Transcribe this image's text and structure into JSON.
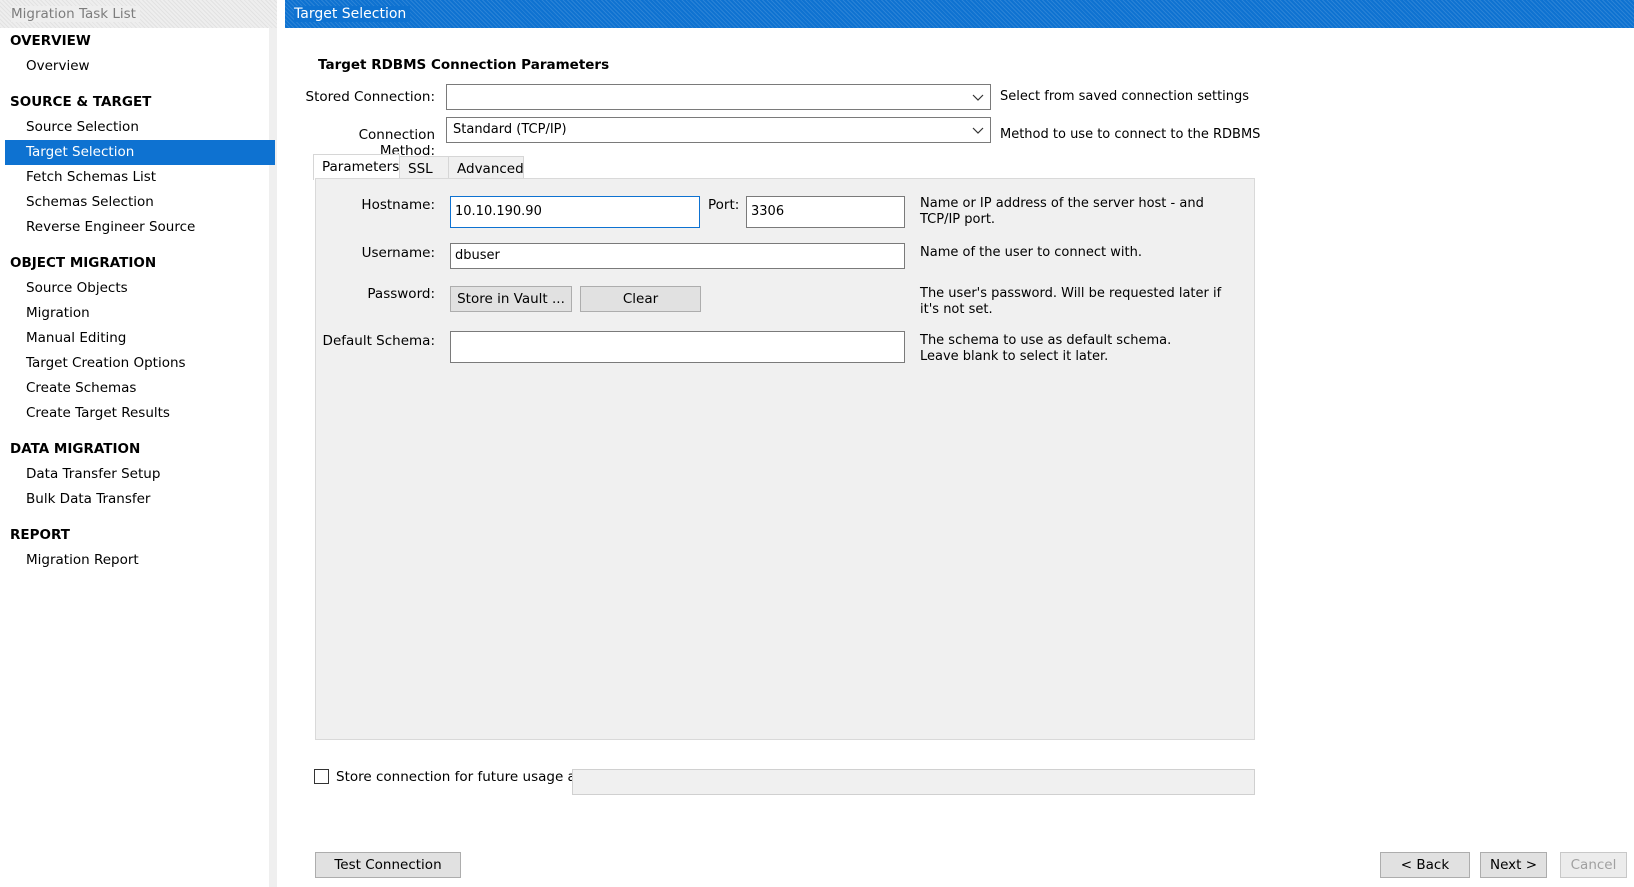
{
  "sidebar": {
    "title": "Migration Task List",
    "sections": [
      {
        "title": "OVERVIEW",
        "items": [
          {
            "label": "Overview"
          }
        ]
      },
      {
        "title": "SOURCE & TARGET",
        "items": [
          {
            "label": "Source Selection"
          },
          {
            "label": "Target Selection",
            "active": true
          },
          {
            "label": "Fetch Schemas List"
          },
          {
            "label": "Schemas Selection"
          },
          {
            "label": "Reverse Engineer Source"
          }
        ]
      },
      {
        "title": "OBJECT MIGRATION",
        "items": [
          {
            "label": "Source Objects"
          },
          {
            "label": "Migration"
          },
          {
            "label": "Manual Editing"
          },
          {
            "label": "Target Creation Options"
          },
          {
            "label": "Create Schemas"
          },
          {
            "label": "Create Target Results"
          }
        ]
      },
      {
        "title": "DATA MIGRATION",
        "items": [
          {
            "label": "Data Transfer Setup"
          },
          {
            "label": "Bulk Data Transfer"
          }
        ]
      },
      {
        "title": "REPORT",
        "items": [
          {
            "label": "Migration Report"
          }
        ]
      }
    ]
  },
  "header": {
    "title": "Target Selection"
  },
  "form": {
    "heading": "Target RDBMS Connection Parameters",
    "stored_connection": {
      "label": "Stored Connection:",
      "value": "",
      "description": "Select from saved connection settings"
    },
    "connection_method": {
      "label": "Connection Method:",
      "value": "Standard (TCP/IP)",
      "description": "Method to use to connect to the RDBMS"
    },
    "tabs": [
      {
        "label": "Parameters",
        "active": true
      },
      {
        "label": "SSL"
      },
      {
        "label": "Advanced"
      }
    ],
    "hostname": {
      "label": "Hostname:",
      "value": "10.10.190.90"
    },
    "port": {
      "label": "Port:",
      "value": "3306"
    },
    "hostname_description": "Name or IP address of the server host - and TCP/IP port.",
    "username": {
      "label": "Username:",
      "value": "dbuser",
      "description": "Name of the user to connect with."
    },
    "password": {
      "label": "Password:",
      "store_button": "Store in Vault ...",
      "clear_button": "Clear",
      "description": "The user's password. Will be requested later if it's not set."
    },
    "default_schema": {
      "label": "Default Schema:",
      "value": "",
      "description": "The schema to use as default schema. Leave blank to select it later."
    },
    "store_connection": {
      "label": "Store connection for future usage as",
      "checked": false,
      "value": ""
    }
  },
  "footer": {
    "test_connection": "Test Connection",
    "back": "< Back",
    "next": "Next >",
    "cancel": "Cancel"
  },
  "colors": {
    "accent": "#0e72d1",
    "panel": "#f0f0f0"
  }
}
